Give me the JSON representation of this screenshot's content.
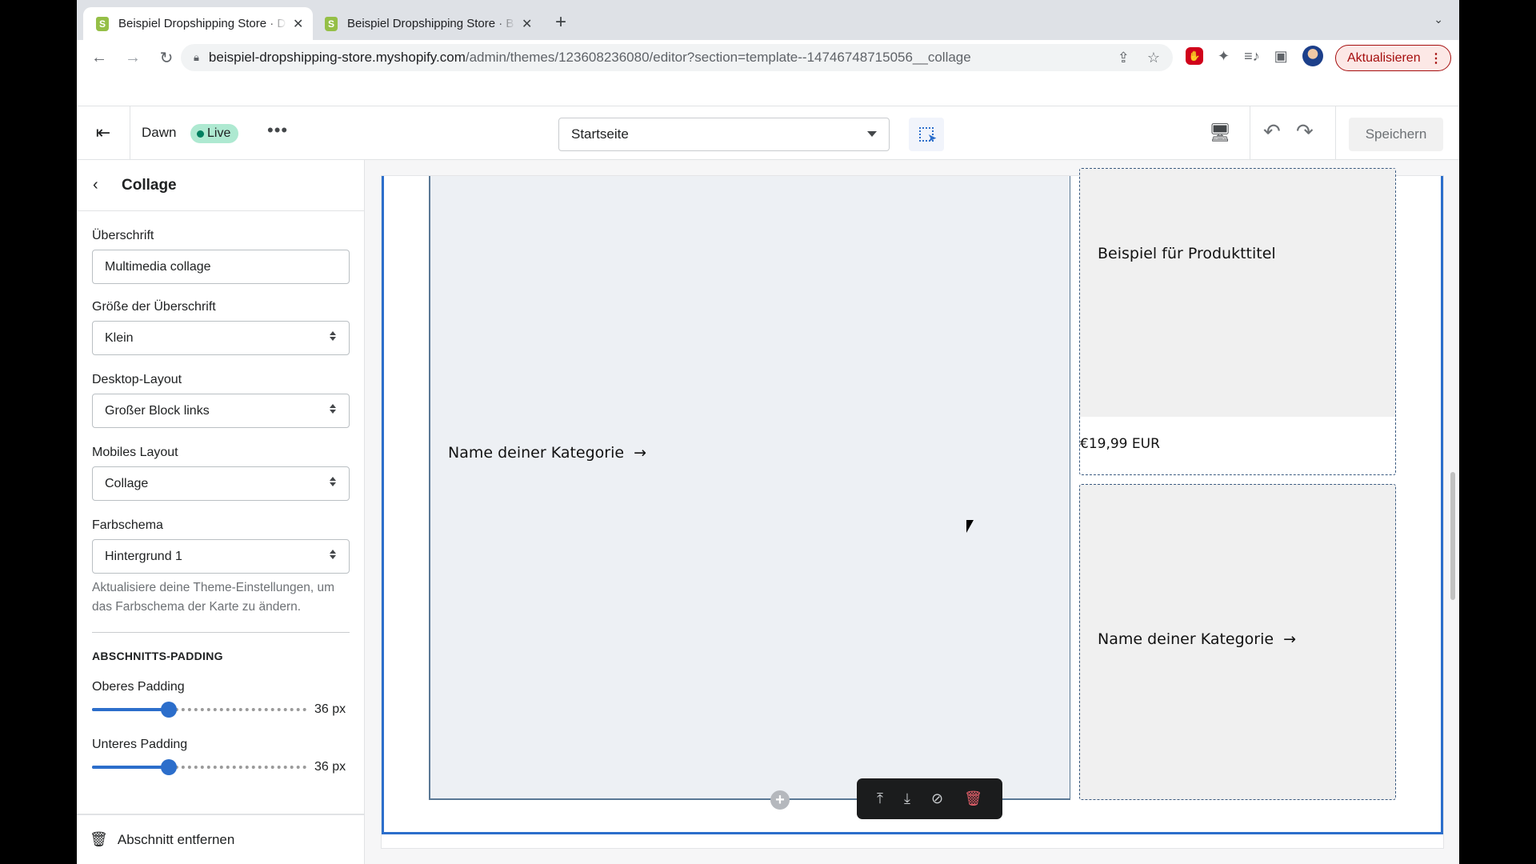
{
  "browser": {
    "tabs": [
      {
        "title": "Beispiel Dropshipping Store · D",
        "active": true
      },
      {
        "title": "Beispiel Dropshipping Store · B",
        "active": false
      }
    ],
    "new_tab_icon": "+",
    "tab_menu_icon": "⌄",
    "url_host": "beispiel-dropshipping-store.myshopify.com",
    "url_path": "/admin/themes/123608236080/editor?section=template--14746748715056__collage",
    "update_button": "Aktualisieren"
  },
  "editor_bar": {
    "theme_name": "Dawn",
    "live_badge": "Live",
    "more_icon": "•••",
    "page_select": "Startseite",
    "save_button": "Speichern",
    "accent_color": "#2c6ecb"
  },
  "sidebar": {
    "title": "Collage",
    "fields": [
      {
        "label": "Überschrift",
        "value": "Multimedia collage",
        "type": "text"
      },
      {
        "label": "Größe der Überschrift",
        "value": "Klein",
        "type": "select"
      },
      {
        "label": "Desktop-Layout",
        "value": "Großer Block links",
        "type": "select"
      },
      {
        "label": "Mobiles Layout",
        "value": "Collage",
        "type": "select"
      },
      {
        "label": "Farbschema",
        "value": "Hintergrund 1",
        "type": "select"
      }
    ],
    "color_help": "Aktualisiere deine Theme-Einstellungen, um das Farbschema der Karte zu ändern.",
    "padding_heading": "ABSCHNITTS-PADDING",
    "sliders": [
      {
        "label": "Oberes Padding",
        "value": 36,
        "display": "36 px",
        "fraction": 0.36
      },
      {
        "label": "Unteres Padding",
        "value": 36,
        "display": "36 px",
        "fraction": 0.36
      }
    ],
    "remove_section": "Abschnitt entfernen"
  },
  "preview": {
    "big_block_link": "Name deiner Kategorie",
    "product_title": "Beispiel für Produkttitel",
    "product_price": "€19,99 EUR",
    "small_block_link": "Name deiner Kategorie",
    "arrow": "→"
  }
}
